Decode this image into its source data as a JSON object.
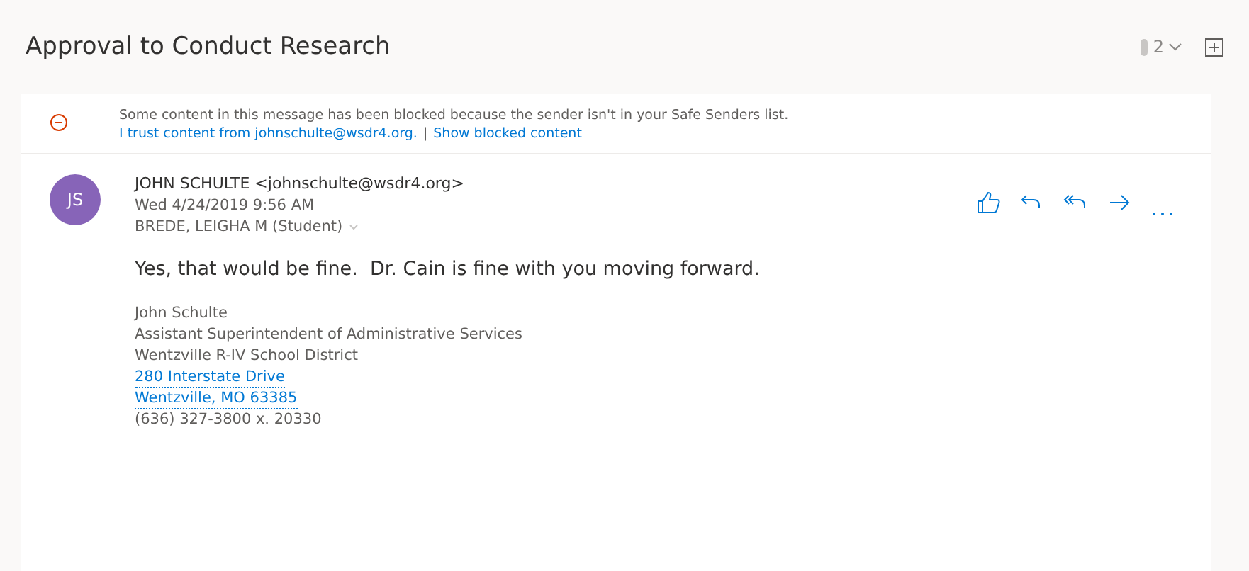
{
  "subject": "Approval to Conduct Research",
  "attachments": {
    "count": "2"
  },
  "banner": {
    "message": "Some content in this message has been blocked because the sender isn't in your Safe Senders list.",
    "links": [
      "I trust content from johnschulte@wsdr4.org.",
      "Show blocked content"
    ],
    "separator": "|"
  },
  "message": {
    "initials": "JS",
    "sender": "JOHN SCHULTE <johnschulte@wsdr4.org>",
    "date": "Wed 4/24/2019 9:56 AM",
    "recipient": "BREDE, LEIGHA M (Student)",
    "body": "Yes, that would be fine.  Dr. Cain is fine with you moving forward.",
    "signature": [
      {
        "text": "John Schulte",
        "kind": "plain"
      },
      {
        "text": "Assistant Superintendent of Administrative Services",
        "kind": "plain"
      },
      {
        "text": "Wentzville R-IV School District",
        "kind": "plain"
      },
      {
        "text": "280 Interstate Drive",
        "kind": "link"
      },
      {
        "text": "Wentzville, MO 63385",
        "kind": "link"
      },
      {
        "text": "(636) 327-3800 x. 20330",
        "kind": "plain"
      }
    ]
  }
}
